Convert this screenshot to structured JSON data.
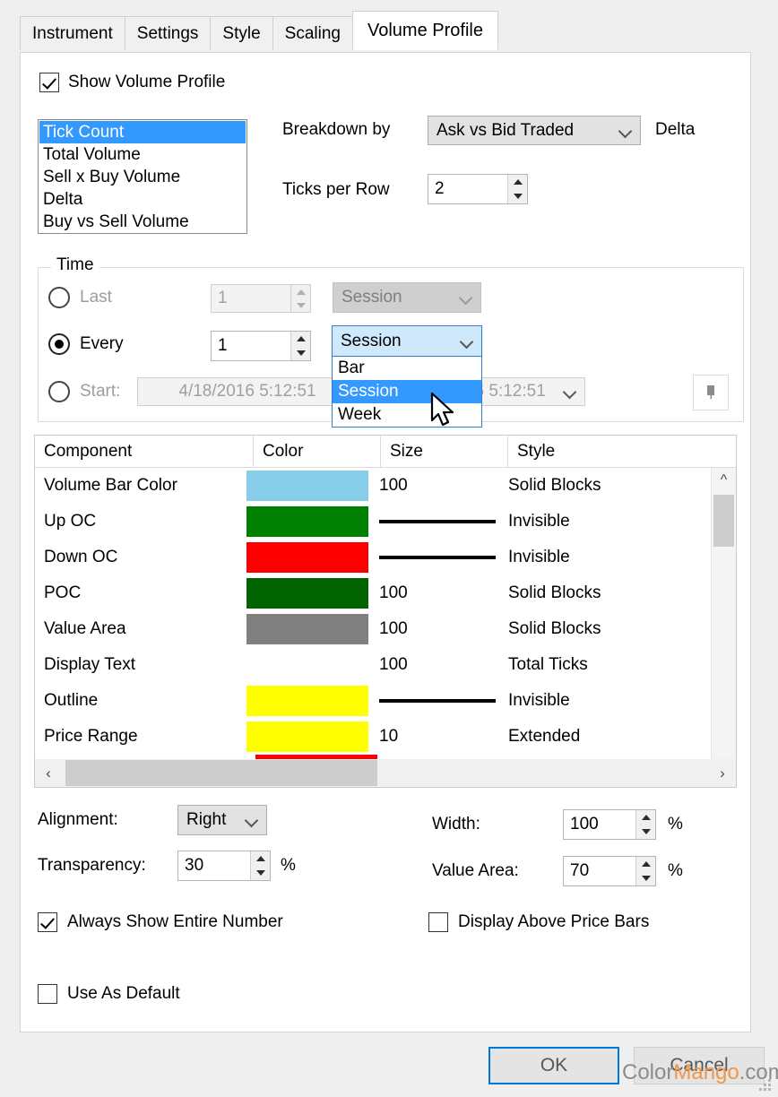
{
  "tabs": [
    {
      "label": "Instrument",
      "active": false
    },
    {
      "label": "Settings",
      "active": false
    },
    {
      "label": "Style",
      "active": false
    },
    {
      "label": "Scaling",
      "active": false
    },
    {
      "label": "Volume Profile",
      "active": true
    }
  ],
  "show_volume_profile": {
    "label": "Show Volume Profile",
    "checked": true
  },
  "profile_types": {
    "items": [
      "Tick Count",
      "Total Volume",
      "Sell x Buy Volume",
      "Delta",
      "Buy vs Sell Volume"
    ],
    "selected": "Tick Count"
  },
  "breakdown": {
    "label": "Breakdown by",
    "value": "Ask vs Bid Traded",
    "trailing_label": "Delta"
  },
  "ticks_per_row": {
    "label": "Ticks per Row",
    "value": "2"
  },
  "time": {
    "title": "Time",
    "last": {
      "label": "Last",
      "selected": false,
      "enabled": false,
      "count": "1",
      "unit": "Session"
    },
    "every": {
      "label": "Every",
      "selected": true,
      "enabled": true,
      "count": "1",
      "unit": "Session"
    },
    "start": {
      "label": "Start:",
      "selected": false,
      "enabled": false,
      "from": "4/18/2016   5:12:51",
      "to": "9/2016   5:12:51"
    },
    "dropdown_open": {
      "header": "Session",
      "options": [
        "Bar",
        "Session",
        "Week"
      ],
      "highlighted": "Session"
    },
    "calendar_button_icon": "calendar-icon"
  },
  "components_table": {
    "headers": [
      "Component",
      "Color",
      "Size",
      "Style"
    ],
    "rows": [
      {
        "name": "Volume Bar Color",
        "color": "#87ceeb",
        "size": "100",
        "size_is_line": false,
        "style": "Solid Blocks"
      },
      {
        "name": "Up OC",
        "color": "#008000",
        "size": "",
        "size_is_line": true,
        "style": "Invisible"
      },
      {
        "name": "Down OC",
        "color": "#ff0000",
        "size": "",
        "size_is_line": true,
        "style": "Invisible"
      },
      {
        "name": "POC",
        "color": "#006400",
        "size": "100",
        "size_is_line": false,
        "style": "Solid Blocks"
      },
      {
        "name": "Value Area",
        "color": "#808080",
        "size": "100",
        "size_is_line": false,
        "style": "Solid Blocks"
      },
      {
        "name": "Display Text",
        "color": "",
        "size": "100",
        "size_is_line": false,
        "style": "Total Ticks"
      },
      {
        "name": "Outline",
        "color": "#ffff00",
        "size": "",
        "size_is_line": true,
        "style": "Invisible"
      },
      {
        "name": "Price Range",
        "color": "#ffff00",
        "size": "10",
        "size_is_line": false,
        "style": "Extended"
      }
    ],
    "partial_next_row_color": "#ff0000"
  },
  "alignment": {
    "label": "Alignment:",
    "value": "Right"
  },
  "transparency": {
    "label": "Transparency:",
    "value": "30",
    "unit": "%"
  },
  "width": {
    "label": "Width:",
    "value": "100",
    "unit": "%"
  },
  "value_area": {
    "label": "Value Area:",
    "value": "70",
    "unit": "%"
  },
  "always_show_entire_number": {
    "label": "Always Show Entire Number",
    "checked": true
  },
  "display_above_price_bars": {
    "label": "Display Above Price Bars",
    "checked": false
  },
  "use_as_default": {
    "label": "Use As Default",
    "checked": false
  },
  "buttons": {
    "ok": "OK",
    "cancel": "Cancel"
  },
  "watermark": {
    "prefix": "Color",
    "brand": "Mango",
    "suffix": ".com"
  }
}
